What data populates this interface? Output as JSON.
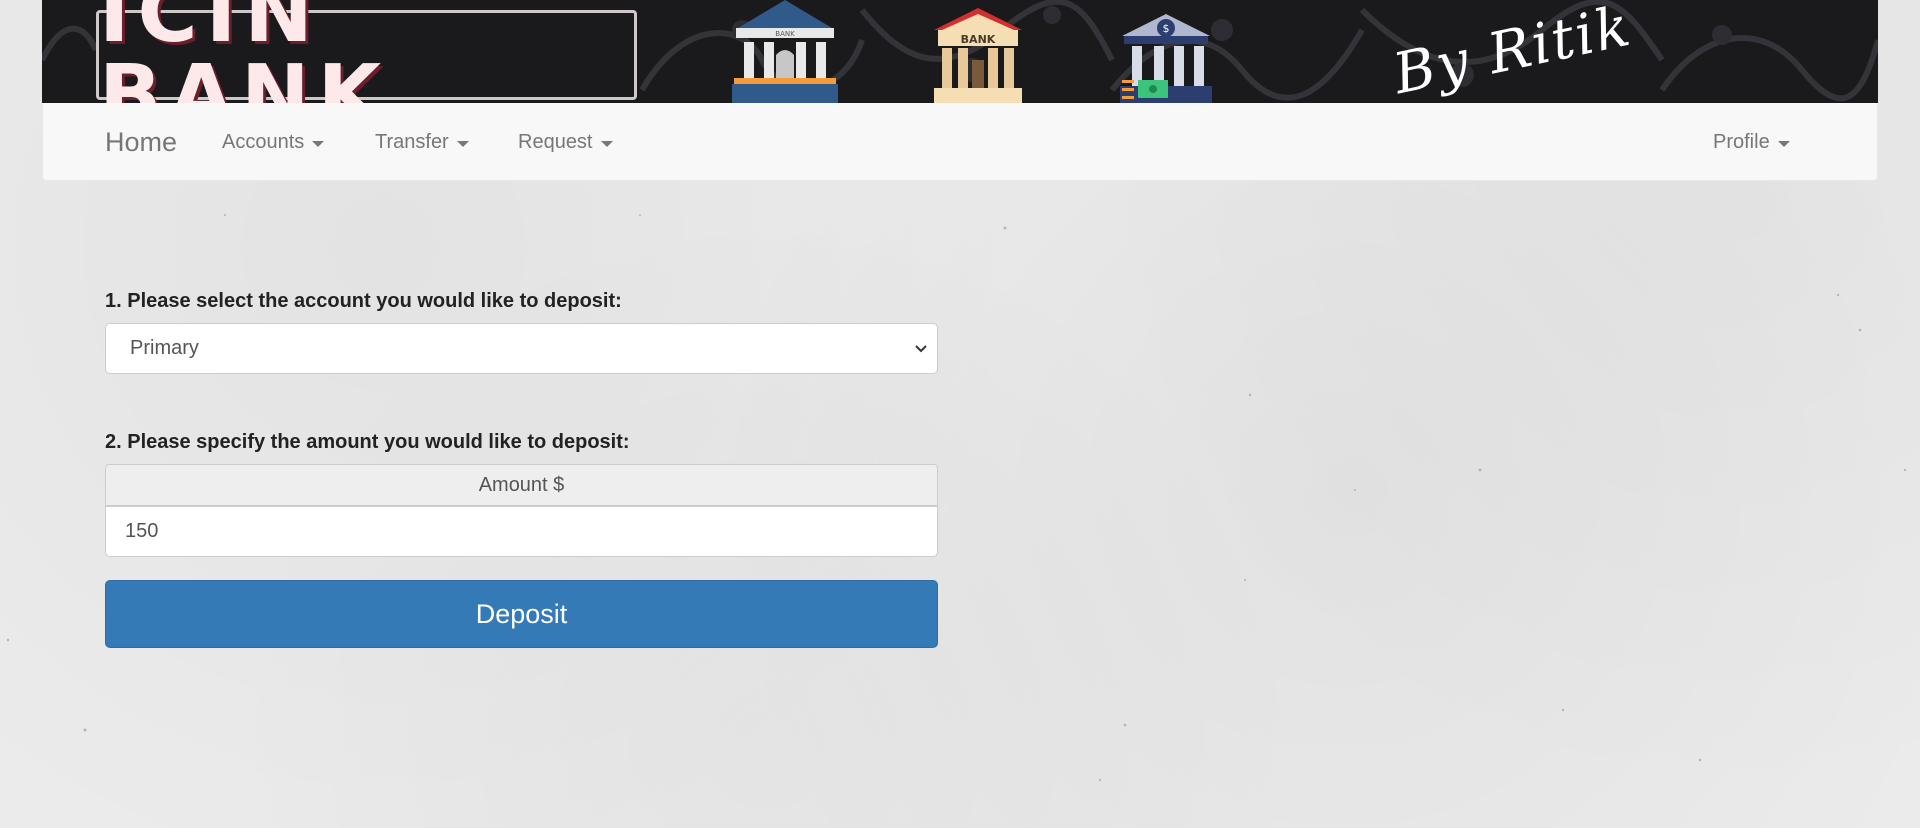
{
  "banner": {
    "logo_text": "ICIN BANK",
    "icon_bank_label": "BANK",
    "signature": "By Ritik"
  },
  "navbar": {
    "brand": "Home",
    "items": [
      {
        "label": "Accounts"
      },
      {
        "label": "Transfer"
      },
      {
        "label": "Request"
      }
    ],
    "profile": "Profile"
  },
  "form": {
    "step1_label": "1. Please select the account you would like to deposit:",
    "account_selected": "Primary",
    "step2_label": "2. Please specify the amount you would like to deposit:",
    "amount_addon": "Amount $",
    "amount_value": "150",
    "submit_label": "Deposit"
  },
  "colors": {
    "primary_button": "#337ab7",
    "navbar_bg": "#f8f8f8",
    "banner_bg": "#1a1a1d"
  }
}
